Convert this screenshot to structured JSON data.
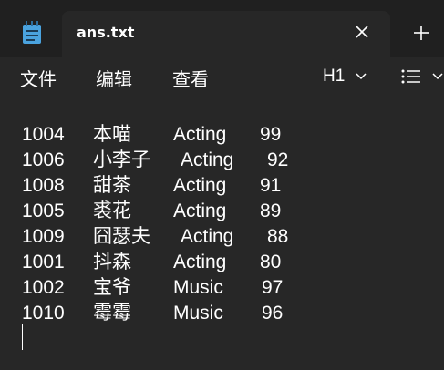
{
  "tab": {
    "title": "ans.txt"
  },
  "icons": {
    "app": "notepad-icon",
    "close": "close-icon",
    "new_tab": "plus-icon",
    "chevron": "chevron-down-icon",
    "list": "list-icon"
  },
  "menu": {
    "file": "文件",
    "edit": "编辑",
    "view": "查看",
    "heading": "H1"
  },
  "rows": [
    {
      "id": "1004",
      "name": "本喵",
      "category": "Acting",
      "score": "99"
    },
    {
      "id": "1006",
      "name": "小李子",
      "category": "Acting",
      "score": "92"
    },
    {
      "id": "1008",
      "name": "甜茶",
      "category": "Acting",
      "score": "91"
    },
    {
      "id": "1005",
      "name": "裘花",
      "category": "Acting",
      "score": "89"
    },
    {
      "id": "1009",
      "name": "囧瑟夫",
      "category": "Acting",
      "score": "88"
    },
    {
      "id": "1001",
      "name": "抖森",
      "category": "Acting",
      "score": "80"
    },
    {
      "id": "1002",
      "name": "宝爷",
      "category": "Music",
      "score": "97"
    },
    {
      "id": "1010",
      "name": "霉霉",
      "category": "Music",
      "score": "96"
    }
  ],
  "colors": {
    "background": "#272727",
    "tabbar": "#202020",
    "icon_blue": "#4aa3df"
  }
}
